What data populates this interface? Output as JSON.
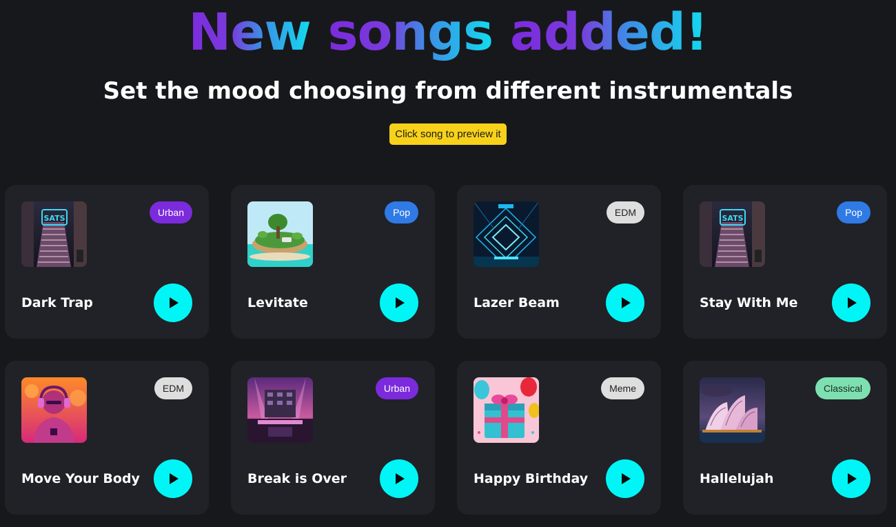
{
  "header": {
    "headline": {
      "word1": "New",
      "word2": "songs",
      "word3": "added!"
    },
    "subtitle": "Set the mood choosing from different instrumentals",
    "hint": "Click song to preview it"
  },
  "songs": [
    {
      "title": "Dark Trap",
      "genre": "Urban",
      "art_icon": "neon-staircase-artwork"
    },
    {
      "title": "Levitate",
      "genre": "Pop",
      "art_icon": "floating-island-artwork"
    },
    {
      "title": "Lazer Beam",
      "genre": "EDM",
      "art_icon": "neon-tunnel-artwork"
    },
    {
      "title": "Stay With Me",
      "genre": "Pop",
      "art_icon": "neon-staircase-artwork"
    },
    {
      "title": "Move Your Body",
      "genre": "EDM",
      "art_icon": "headphones-person-artwork"
    },
    {
      "title": "Break is Over",
      "genre": "Urban",
      "art_icon": "concert-stage-artwork"
    },
    {
      "title": "Happy Birthday",
      "genre": "Meme",
      "art_icon": "gift-balloons-artwork"
    },
    {
      "title": "Hallelujah",
      "genre": "Classical",
      "art_icon": "opera-house-artwork"
    }
  ],
  "colors": {
    "background": "#17181c",
    "card": "#202227",
    "play_button": "#00f6f6",
    "hint_background": "#f8d21a",
    "genre_urban": "#7b2bdc",
    "genre_pop": "#2f7ae5",
    "genre_edm": "#dedede",
    "genre_meme": "#dedede",
    "genre_classical": "#7ee0b0",
    "headline_gradient": [
      "#7b2bdc",
      "#3d8ee6",
      "#12dcef"
    ]
  }
}
